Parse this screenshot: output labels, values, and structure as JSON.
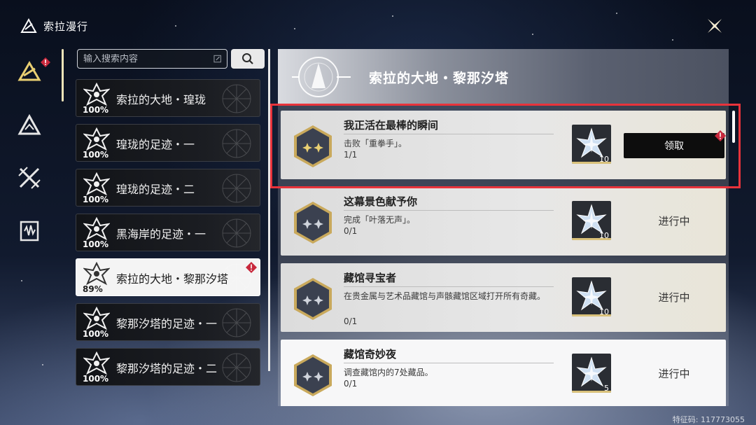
{
  "header": {
    "title": "索拉漫行"
  },
  "search": {
    "placeholder": "输入搜索内容"
  },
  "regions": [
    {
      "label": "索拉的大地・瑝珑",
      "percent": "100%",
      "active": false,
      "alert": false
    },
    {
      "label": "瑝珑的足迹・一",
      "percent": "100%",
      "active": false,
      "alert": false
    },
    {
      "label": "瑝珑的足迹・二",
      "percent": "100%",
      "active": false,
      "alert": false
    },
    {
      "label": "黑海岸的足迹・一",
      "percent": "100%",
      "active": false,
      "alert": false
    },
    {
      "label": "索拉的大地・黎那汐塔",
      "percent": "89%",
      "active": true,
      "alert": true
    },
    {
      "label": "黎那汐塔的足迹・一",
      "percent": "100%",
      "active": false,
      "alert": false
    },
    {
      "label": "黎那汐塔的足迹・二",
      "percent": "100%",
      "active": false,
      "alert": false
    }
  ],
  "panel": {
    "title": "索拉的大地・黎那汐塔"
  },
  "quests": [
    {
      "title": "我正活在最棒的瞬间",
      "desc": "击败「重拳手」。",
      "progress": "1/1",
      "reward_count": "10",
      "status": "领取",
      "claimable": true,
      "gold_icon": true
    },
    {
      "title": "这幕景色献予你",
      "desc": "完成「叶落无声」。",
      "progress": "0/1",
      "reward_count": "10",
      "status": "进行中",
      "claimable": false,
      "gold_icon": false
    },
    {
      "title": "藏馆寻宝者",
      "desc": "在贵金属与艺术品藏馆与声骸藏馆区域打开所有奇藏。",
      "progress": "0/1",
      "reward_count": "10",
      "status": "进行中",
      "claimable": false,
      "gold_icon": false
    },
    {
      "title": "藏馆奇妙夜",
      "desc": "调查藏馆内的7处藏品。",
      "progress": "0/1",
      "reward_count": "5",
      "status": "进行中",
      "claimable": false,
      "gold_icon": false
    }
  ],
  "watermark": "特征码: 117773055",
  "colors": {
    "accent_gold": "#e9cf72",
    "alert_red": "#c8283c",
    "highlight_red": "#e8333b"
  },
  "icons": {
    "nav": [
      "solaris-icon",
      "mountain-icon",
      "crossed-swords-icon",
      "soundwave-icon"
    ],
    "reward": "star-crystal-icon"
  }
}
